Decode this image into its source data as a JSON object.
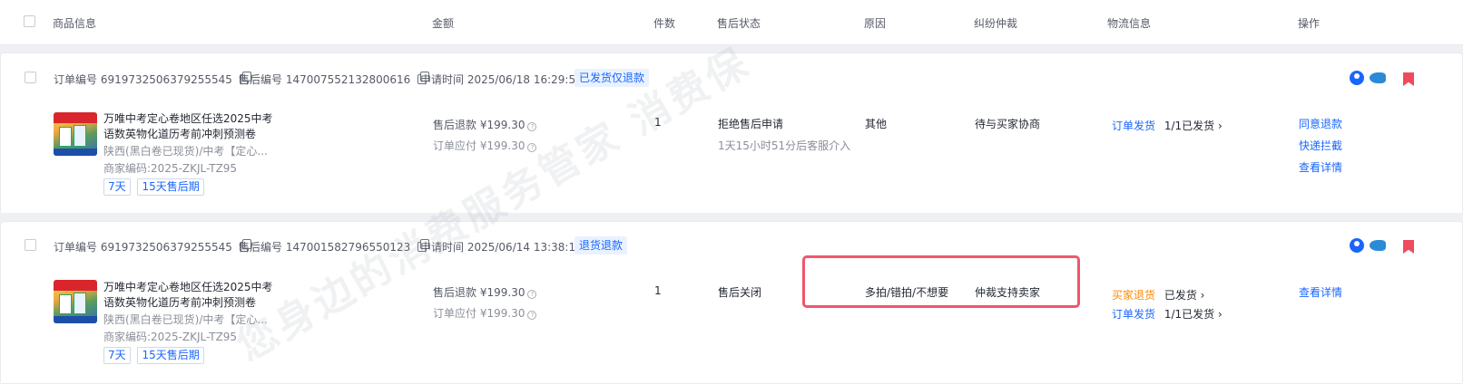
{
  "header": {
    "columns": {
      "product": "商品信息",
      "amount": "金额",
      "qty": "件数",
      "status": "售后状态",
      "reason": "原因",
      "arbitration": "纠纷仲裁",
      "logistics": "物流信息",
      "action": "操作"
    }
  },
  "orders": [
    {
      "order_label": "订单编号",
      "order_no": "6919732506379255545",
      "aftersale_label": "售后编号",
      "aftersale_no": "147007552132800616",
      "apply_label": "申请时间",
      "apply_time": "2025/06/18 16:29:57",
      "type_tag": "已发货仅退款",
      "product_title_line1": "万唯中考定心卷地区任选2025中考",
      "product_title_line2": "语数英物化道历考前冲刺预测卷",
      "product_spec": "陕西(黑白卷已现货)/中考【定心...",
      "merchant_code": "商家编码:2025-ZKJL-TZ95",
      "tags": [
        "7天",
        "15天售后期"
      ],
      "refund_label": "售后退款",
      "refund_amount": "¥199.30",
      "due_label": "订单应付",
      "due_amount": "¥199.30",
      "qty": "1",
      "status": "拒绝售后申请",
      "status_sub": "1天15小时51分后客服介入",
      "reason": "其他",
      "arbitration": "待与买家协商",
      "logistics": [
        {
          "type": "订单发货",
          "type_color": "blue",
          "info": "1/1已发货 ›"
        }
      ],
      "actions": [
        "同意退款",
        "快递拦截",
        "查看详情"
      ]
    },
    {
      "order_label": "订单编号",
      "order_no": "6919732506379255545",
      "aftersale_label": "售后编号",
      "aftersale_no": "147001582796550123",
      "apply_label": "申请时间",
      "apply_time": "2025/06/14 13:38:12",
      "type_tag": "退货退款",
      "product_title_line1": "万唯中考定心卷地区任选2025中考",
      "product_title_line2": "语数英物化道历考前冲刺预测卷",
      "product_spec": "陕西(黑白卷已现货)/中考【定心...",
      "merchant_code": "商家编码:2025-ZKJL-TZ95",
      "tags": [
        "7天",
        "15天售后期"
      ],
      "refund_label": "售后退款",
      "refund_amount": "¥199.30",
      "due_label": "订单应付",
      "due_amount": "¥199.30",
      "qty": "1",
      "status": "售后关闭",
      "status_sub": "",
      "reason": "多拍/错拍/不想要",
      "arbitration": "仲裁支持卖家",
      "logistics": [
        {
          "type": "买家退货",
          "type_color": "orange",
          "info": "已发货 ›"
        },
        {
          "type": "订单发货",
          "type_color": "blue",
          "info": "1/1已发货 ›"
        }
      ],
      "actions": [
        "查看详情"
      ]
    }
  ],
  "watermark": "您身边的消费服务管家 消费保",
  "colors": {
    "link_blue": "#1966ff",
    "orange": "#ff8a00",
    "highlight": "#f0566b",
    "flag_red": "#f04b5a"
  }
}
